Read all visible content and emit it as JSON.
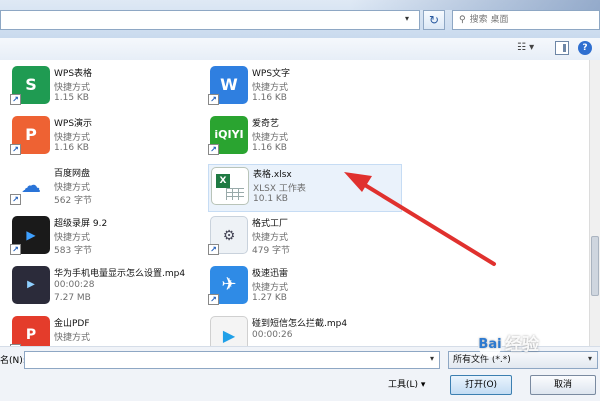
{
  "topbar": {
    "refresh_glyph": "↻",
    "dropdown_glyph": "▾",
    "search_placeholder": "搜索 桌面",
    "search_icon": "search-icon"
  },
  "toolbar": {
    "view_glyph": "☷ ▾",
    "help_glyph": "?"
  },
  "files": [
    {
      "name": "WPS表格",
      "type": "快捷方式",
      "size": "1.15 KB",
      "icon": "wps-spreadsheet-icon",
      "glyph": "S",
      "shortcut": true
    },
    {
      "name": "WPS文字",
      "type": "快捷方式",
      "size": "1.16 KB",
      "icon": "wps-writer-icon",
      "glyph": "W",
      "shortcut": true
    },
    {
      "name": "WPS演示",
      "type": "快捷方式",
      "size": "1.16 KB",
      "icon": "wps-presentation-icon",
      "glyph": "P",
      "shortcut": true
    },
    {
      "name": "爱奇艺",
      "type": "快捷方式",
      "size": "1.16 KB",
      "icon": "iqiyi-icon",
      "glyph": "iQIYI",
      "shortcut": true
    },
    {
      "name": "百度网盘",
      "type": "快捷方式",
      "size": "562 字节",
      "icon": "baidu-netdisk-icon",
      "glyph": "☁",
      "shortcut": true
    },
    {
      "name": "表格.xlsx",
      "type": "XLSX 工作表",
      "size": "10.1 KB",
      "icon": "excel-file-icon",
      "glyph": "X",
      "shortcut": false,
      "selected": true
    },
    {
      "name": "超级录屏 9.2",
      "type": "快捷方式",
      "size": "583 字节",
      "icon": "screen-recorder-icon",
      "glyph": "▶",
      "shortcut": true
    },
    {
      "name": "格式工厂",
      "type": "快捷方式",
      "size": "479 字节",
      "icon": "format-factory-icon",
      "glyph": "⚙",
      "shortcut": true
    },
    {
      "name": "华为手机电量显示怎么设置.mp4",
      "type": "00:00:28",
      "size": "7.27 MB",
      "icon": "video-thumbnail-icon",
      "glyph": "▶",
      "shortcut": false
    },
    {
      "name": "极速迅雷",
      "type": "快捷方式",
      "size": "1.27 KB",
      "icon": "xunlei-icon",
      "glyph": "✈",
      "shortcut": true
    },
    {
      "name": "金山PDF",
      "type": "快捷方式",
      "size": "",
      "icon": "kingsoft-pdf-icon",
      "glyph": "P",
      "shortcut": true
    },
    {
      "name": "碰到短信怎么拦截.mp4",
      "type": "00:00:26",
      "size": "",
      "icon": "media-file-icon",
      "glyph": "▶",
      "shortcut": false
    }
  ],
  "bottom": {
    "filename_label": "名(N):",
    "filename_value": "",
    "filter_value": "所有文件 (*.*)",
    "tools_label": "工具(L) ▾",
    "open_label": "打开(O)",
    "cancel_label": "取消"
  },
  "watermark": {
    "text": "经验",
    "brand": "Bai"
  },
  "colors": {
    "accent": "#2f6fd0",
    "selection": "#eaf2fb",
    "arrow": "#e0312e"
  }
}
